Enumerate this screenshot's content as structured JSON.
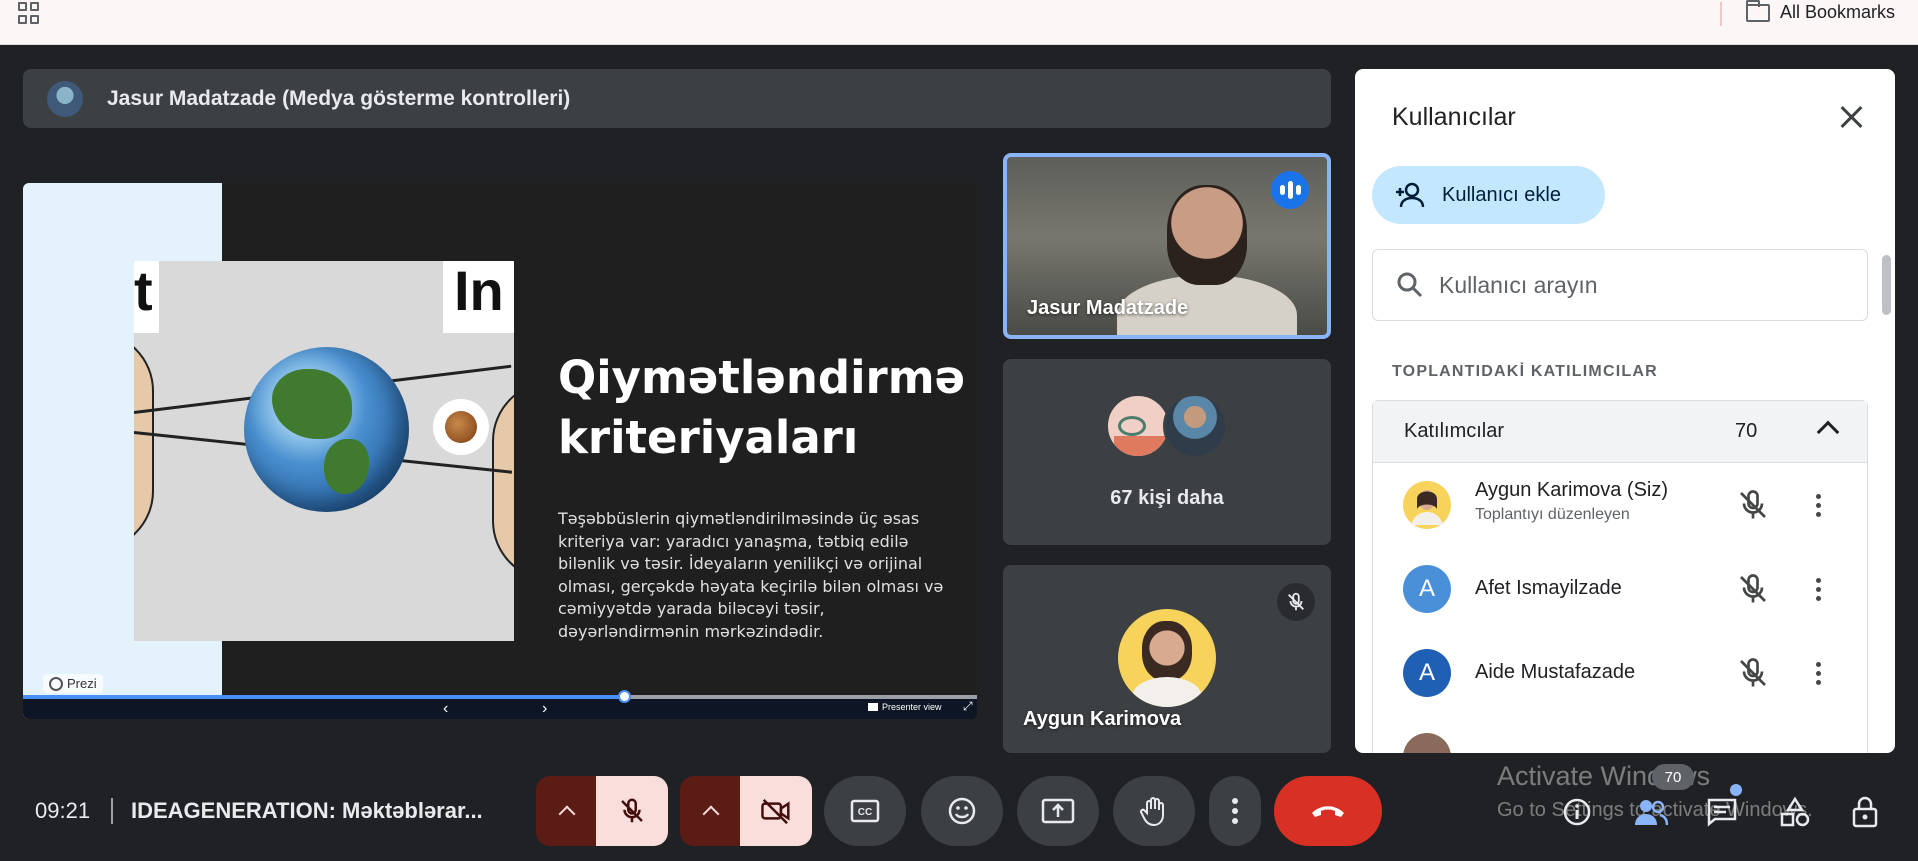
{
  "bookmarks_bar": {
    "all_bookmarks": "All Bookmarks",
    "icons": [
      "apps-grid-icon",
      "folder-icon"
    ]
  },
  "presenter": {
    "title": "Jasur Madatzade (Medya gösterme kontrolleri)"
  },
  "slide": {
    "img_text_left": "t",
    "img_text_right": "In",
    "title": "Qiymətləndirmə kriteriyaları",
    "body": "Təşəbbüslerin qiymətləndirilməsində üç əsas kriteriya var: yaradıcı yanaşma, tətbiq edilə bilənlik və təsir. İdeyaların yenilikçi və orijinal olması, gerçəkdə həyata keçirilə bilən olması və cəmiyyətdə yarada biləcəyi təsir, dəyərləndirmənin mərkəzindədir.",
    "prezi_label": "Prezi",
    "prev": "‹",
    "next": "›",
    "presenter_view": "Presenter view",
    "expand": "⤢",
    "progress": 0.63
  },
  "tiles": {
    "speaker": {
      "name": "Jasur Madatzade",
      "status": "speaking"
    },
    "more": {
      "label": "67 kişi daha"
    },
    "self": {
      "name": "Aygun Karimova",
      "mic": "off"
    }
  },
  "panel": {
    "title": "Kullanıcılar",
    "add_user": "Kullanıcı ekle",
    "search_placeholder": "Kullanıcı arayın",
    "section": "TOPLANTIDAKİ KATILIMCILAR",
    "group_label": "Katılımcılar",
    "group_count": "70",
    "participants": [
      {
        "name": "Aygun Karimova (Siz)",
        "sub": "Toplantıyı düzenleyen",
        "initial": "",
        "avatar_color": "#f7d35c"
      },
      {
        "name": "Afet Ismayilzade",
        "sub": "",
        "initial": "A",
        "avatar_color": "#4a90d9"
      },
      {
        "name": "Aide Mustafazade",
        "sub": "",
        "initial": "A",
        "avatar_color": "#1f5fb4"
      }
    ]
  },
  "bottom": {
    "time": "09:21",
    "meeting": "IDEAGENERATION: Məktəblərar...",
    "people_badge": "70",
    "watermark_line1": "Activate Windows",
    "watermark_line2": "Go to Settings to activate Windows."
  },
  "colors": {
    "accent": "#8ab4f8",
    "end_call": "#d93025",
    "muted_dark": "#5c1c16",
    "muted_light": "#f9dedc",
    "add_button": "#c2e7ff"
  }
}
